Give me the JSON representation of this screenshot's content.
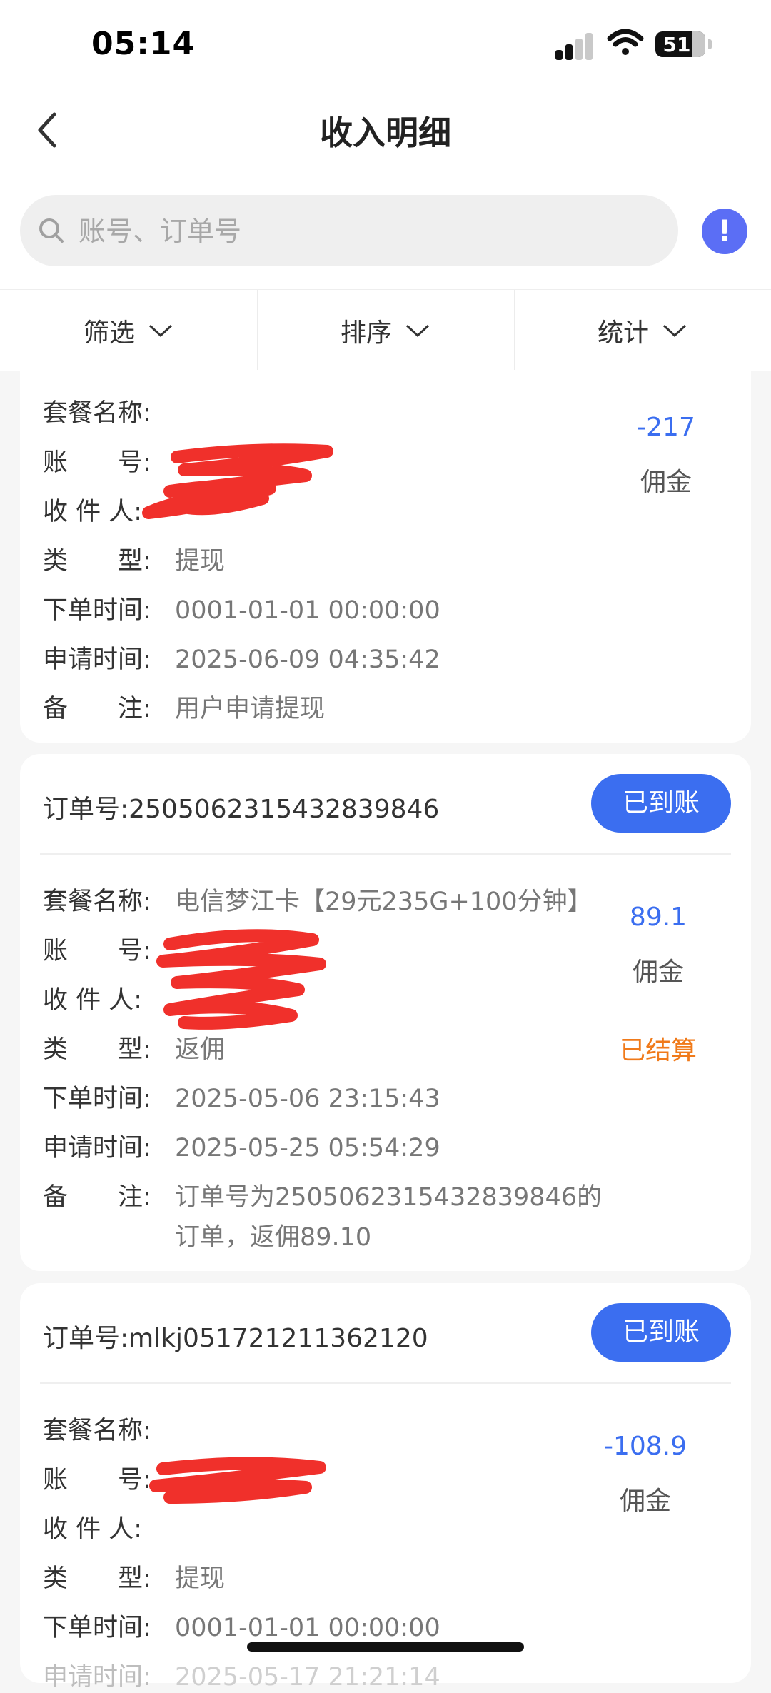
{
  "status": {
    "time": "05:14",
    "battery": "51"
  },
  "header": {
    "title": "收入明细"
  },
  "search": {
    "placeholder": "账号、订单号",
    "info": "!"
  },
  "filters": [
    {
      "label": "筛选"
    },
    {
      "label": "排序"
    },
    {
      "label": "统计"
    }
  ],
  "labels": {
    "package": "套餐名称:",
    "account": "账　　号:",
    "receiver": "收 件 人:",
    "type": "类　　型:",
    "order_time": "下单时间:",
    "apply_time": "申请时间:",
    "note": "备　　注:",
    "order_no": "订单号:"
  },
  "records": [
    {
      "package": "",
      "type": "提现",
      "order_time": "0001-01-01 00:00:00",
      "apply_time": "2025-06-09 04:35:42",
      "note": "用户申请提现",
      "amount": "-217",
      "amount_label": "佣金"
    },
    {
      "order_no": "2505062315432839846",
      "status": "已到账",
      "package": "电信梦江卡【29元235G+100分钟】",
      "type": "返佣",
      "order_time": "2025-05-06 23:15:43",
      "apply_time": "2025-05-25 05:54:29",
      "note_line1": "订单号为2505062315432839846的",
      "note_line2": "订单，返佣89.10",
      "amount": "89.1",
      "amount_label": "佣金",
      "settle": "已结算"
    },
    {
      "order_no": "mlkj051721211362120",
      "status": "已到账",
      "package": "",
      "type": "提现",
      "order_time": "0001-01-01 00:00:00",
      "apply_time_partial": "2025-05-17 21:21:14",
      "amount": "-108.9",
      "amount_label": "佣金"
    }
  ],
  "colors": {
    "accent": "#3b6ef0",
    "settled": "#f07a1a",
    "redaction": "#f0302b"
  }
}
